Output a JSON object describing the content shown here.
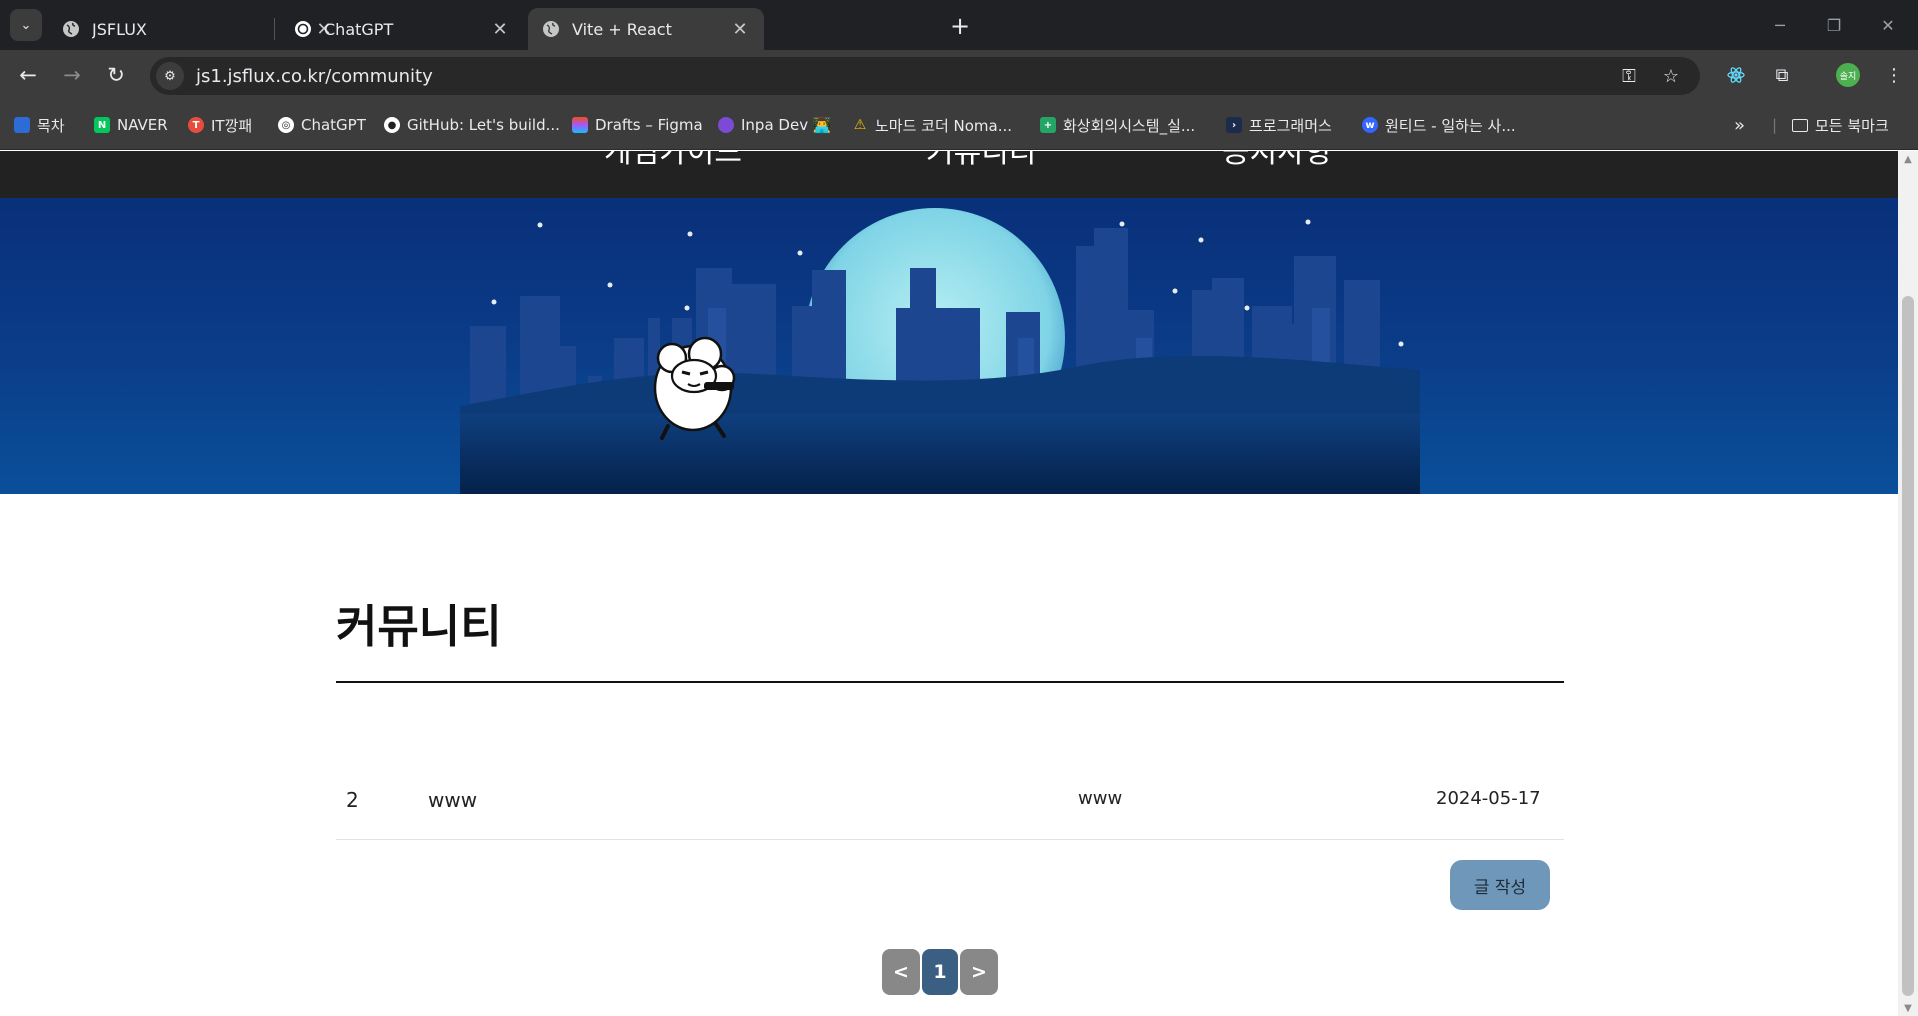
{
  "browser": {
    "tabs": [
      {
        "title": "JSFLUX",
        "active": false
      },
      {
        "title": "ChatGPT",
        "active": false
      },
      {
        "title": "Vite + React",
        "active": true
      }
    ],
    "address": "js1.jsflux.co.kr/community",
    "bookmarks": [
      {
        "label": "목차",
        "icon": "bookmark-doc-icon"
      },
      {
        "label": "NAVER",
        "icon": "naver-icon"
      },
      {
        "label": "IT깡패",
        "icon": "itggang-icon"
      },
      {
        "label": "ChatGPT",
        "icon": "chatgpt-icon"
      },
      {
        "label": "GitHub: Let's build...",
        "icon": "github-icon"
      },
      {
        "label": "Drafts – Figma",
        "icon": "figma-icon"
      },
      {
        "label": "Inpa Dev 👨‍💻",
        "icon": "inpa-icon"
      },
      {
        "label": "노마드 코더 Noma...",
        "icon": "nomad-icon"
      },
      {
        "label": "화상회의시스템_실...",
        "icon": "sheets-icon"
      },
      {
        "label": "프로그래머스",
        "icon": "programmers-icon"
      },
      {
        "label": "원티드 - 일하는 사...",
        "icon": "wanted-icon"
      }
    ],
    "all_bookmarks": "모든 북마크",
    "profile_initials": "솔지"
  },
  "site": {
    "nav": [
      "게임가이드",
      "커뮤니티",
      "공지사항"
    ],
    "page_title": "커뮤니티",
    "posts": [
      {
        "id": "2",
        "title": "www",
        "author": "www",
        "date": "2024-05-17"
      }
    ],
    "write_button": "글 작성",
    "pagination": {
      "prev": "<",
      "current": "1",
      "next": ">"
    }
  },
  "colors": {
    "write_button": "#6f97b9",
    "page_current": "#3a5f82",
    "page_arrow": "#888888"
  }
}
